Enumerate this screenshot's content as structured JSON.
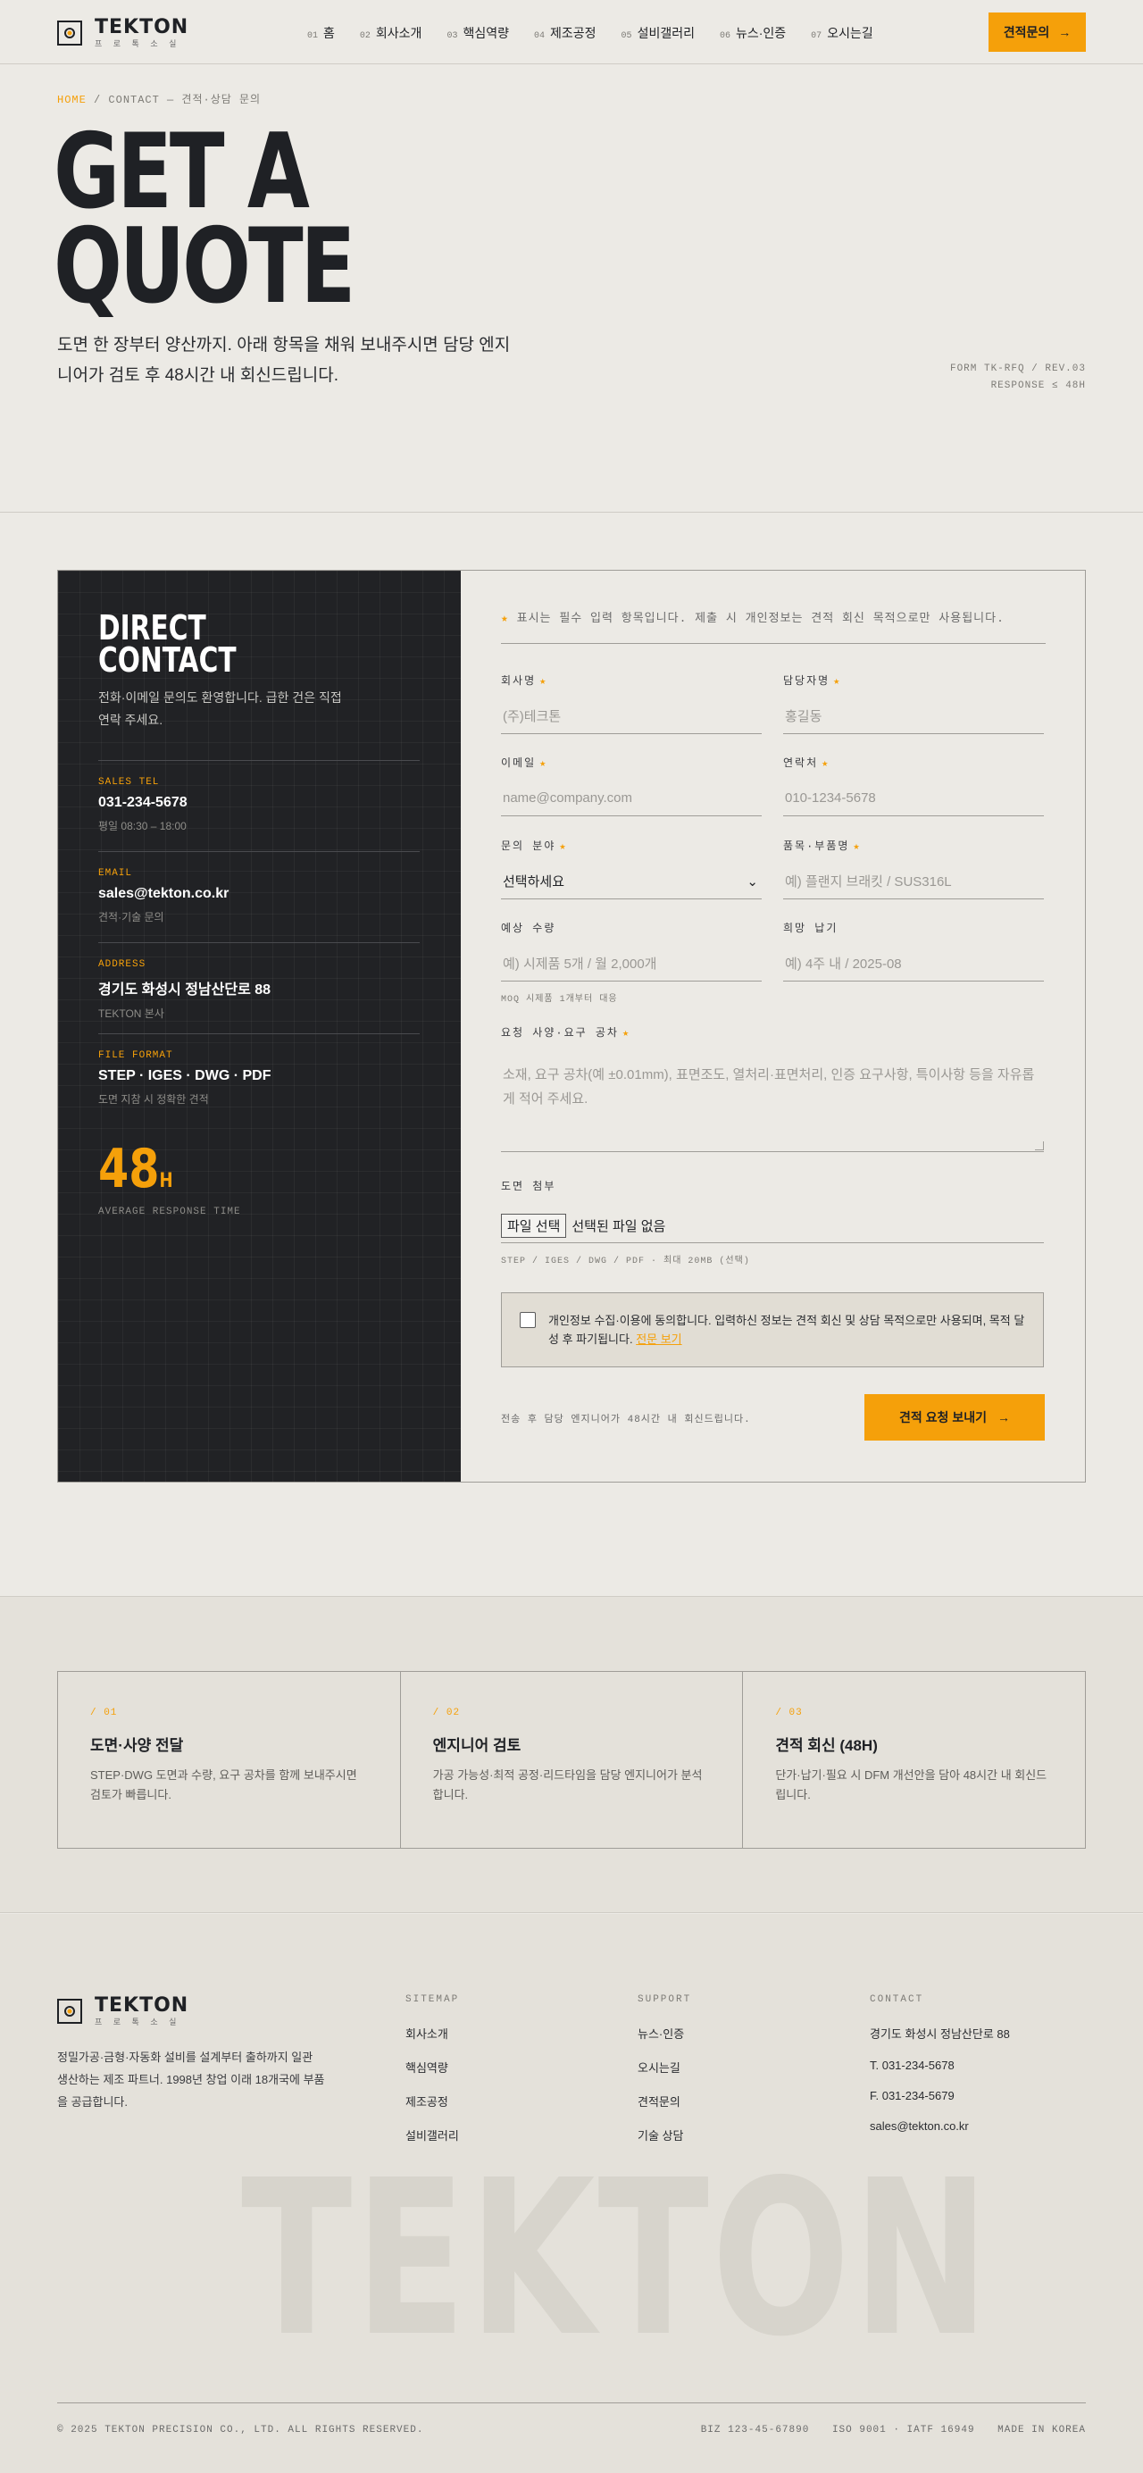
{
  "header": {
    "logo_name": "TEKTON",
    "logo_sub": "프 로 톡 소 실",
    "nav": [
      {
        "num": "01",
        "label": "홈"
      },
      {
        "num": "02",
        "label": "회사소개"
      },
      {
        "num": "03",
        "label": "핵심역량"
      },
      {
        "num": "04",
        "label": "제조공정"
      },
      {
        "num": "05",
        "label": "설비갤러리"
      },
      {
        "num": "06",
        "label": "뉴스·인증"
      },
      {
        "num": "07",
        "label": "오시는길"
      }
    ],
    "cta_label": "견적문의",
    "cta_arrow": "→"
  },
  "hero": {
    "crumb_home": "HOME",
    "crumb_sep": "/",
    "crumb_rest": "CONTACT — 견적·상담 문의",
    "title": "GET A\nQUOTE",
    "description": "도면 한 장부터 양산까지. 아래 항목을 채워 보내주시면 담당 엔지니어가 검토 후 48시간 내 회신드립니다.",
    "meta_line1": "FORM TK-RFQ / REV.03",
    "meta_line2": "RESPONSE ≤ 48H"
  },
  "contact": {
    "title": "DIRECT\nCONTACT",
    "description": "전화·이메일 문의도 환영합니다. 급한 건은 직접 연락 주세요.",
    "blocks": [
      {
        "label": "SALES TEL",
        "value": "031-234-5678",
        "note": "평일 08:30 – 18:00"
      },
      {
        "label": "EMAIL",
        "value": "sales@tekton.co.kr",
        "note": "견적·기술 문의"
      },
      {
        "label": "ADDRESS",
        "value": "경기도 화성시 정남산단로 88",
        "note": "TEKTON 본사"
      },
      {
        "label": "FILE FORMAT",
        "value": "STEP · IGES · DWG · PDF",
        "note": "도면 지참 시 정확한 견적"
      }
    ],
    "big_number": "48",
    "big_unit": "H",
    "big_label": "AVERAGE RESPONSE TIME"
  },
  "form": {
    "required_note_star": "★",
    "required_note": "표시는 필수 입력 항목입니다. 제출 시 개인정보는 견적 회신 목적으로만 사용됩니다.",
    "star": "★",
    "fields": {
      "company": {
        "label": "회사명",
        "placeholder": "(주)테크톤"
      },
      "manager": {
        "label": "담당자명",
        "placeholder": "홍길동"
      },
      "email": {
        "label": "이메일",
        "placeholder": "name@company.com"
      },
      "phone": {
        "label": "연락처",
        "placeholder": "010-1234-5678"
      },
      "category": {
        "label": "문의 분야",
        "value": "선택하세요",
        "chevron": "⌄"
      },
      "product": {
        "label": "품목·부품명",
        "placeholder": "예) 플랜지 브래킷 / SUS316L"
      },
      "quantity": {
        "label": "예상 수량",
        "placeholder": "예) 시제품 5개 / 월 2,000개",
        "hint": "MOQ 시제품 1개부터 대응"
      },
      "deadline": {
        "label": "희망 납기",
        "placeholder": "예) 4주 내 / 2025-08"
      },
      "requirements": {
        "label": "요청 사양·요구 공차",
        "placeholder": "소재, 요구 공차(예 ±0.01mm), 표면조도, 열처리·표면처리, 인증 요구사항, 특이사항 등을 자유롭게 적어 주세요."
      },
      "attachment": {
        "label": "도면 첨부",
        "button": "파일 선택",
        "status": "선택된 파일 없음",
        "hint": "STEP / IGES / DWG / PDF · 최대 20MB (선택)"
      }
    },
    "consent_text": "개인정보 수집·이용에 동의합니다. 입력하신 정보는 견적 회신 및 상담 목적으로만 사용되며, 목적 달성 후 파기됩니다.",
    "consent_link": "전문 보기",
    "submit_note": "전송 후 담당 엔지니어가 48시간 내 회신드립니다.",
    "submit_label": "견적 요청 보내기",
    "submit_arrow": "→"
  },
  "process": [
    {
      "num": "/ 01",
      "title": "도면·사양 전달",
      "desc": "STEP·DWG 도면과 수량, 요구 공차를 함께 보내주시면 검토가 빠릅니다."
    },
    {
      "num": "/ 02",
      "title": "엔지니어 검토",
      "desc": "가공 가능성·최적 공정·리드타임을 담당 엔지니어가 분석합니다."
    },
    {
      "num": "/ 03",
      "title": "견적 회신 (48H)",
      "desc": "단가·납기·필요 시 DFM 개선안을 담아 48시간 내 회신드립니다."
    }
  ],
  "footer": {
    "logo_name": "TEKTON",
    "logo_sub": "프 로 톡 소 실",
    "about": "정밀가공·금형·자동화 설비를 설계부터 출하까지 일관 생산하는 제조 파트너. 1998년 창업 이래 18개국에 부품을 공급합니다.",
    "columns": [
      {
        "title": "SITEMAP",
        "links": [
          "회사소개",
          "핵심역량",
          "제조공정",
          "설비갤러리"
        ]
      },
      {
        "title": "SUPPORT",
        "links": [
          "뉴스·인증",
          "오시는길",
          "견적문의",
          "기술 상담"
        ]
      },
      {
        "title": "CONTACT",
        "links": [
          "경기도 화성시 정남산단로 88",
          "T. 031-234-5678",
          "F. 031-234-5679",
          "sales@tekton.co.kr"
        ]
      }
    ],
    "watermark": "TEKTON",
    "copyright": "© 2025 TEKTON PRECISION CO., LTD. ALL RIGHTS RESERVED.",
    "biz": "BIZ 123-45-67890",
    "iso": "ISO 9001 · IATF 16949",
    "made": "MADE IN KOREA"
  },
  "colors": {
    "accent": "#f5a00a",
    "dark": "#212225",
    "background": "#eceae5"
  }
}
